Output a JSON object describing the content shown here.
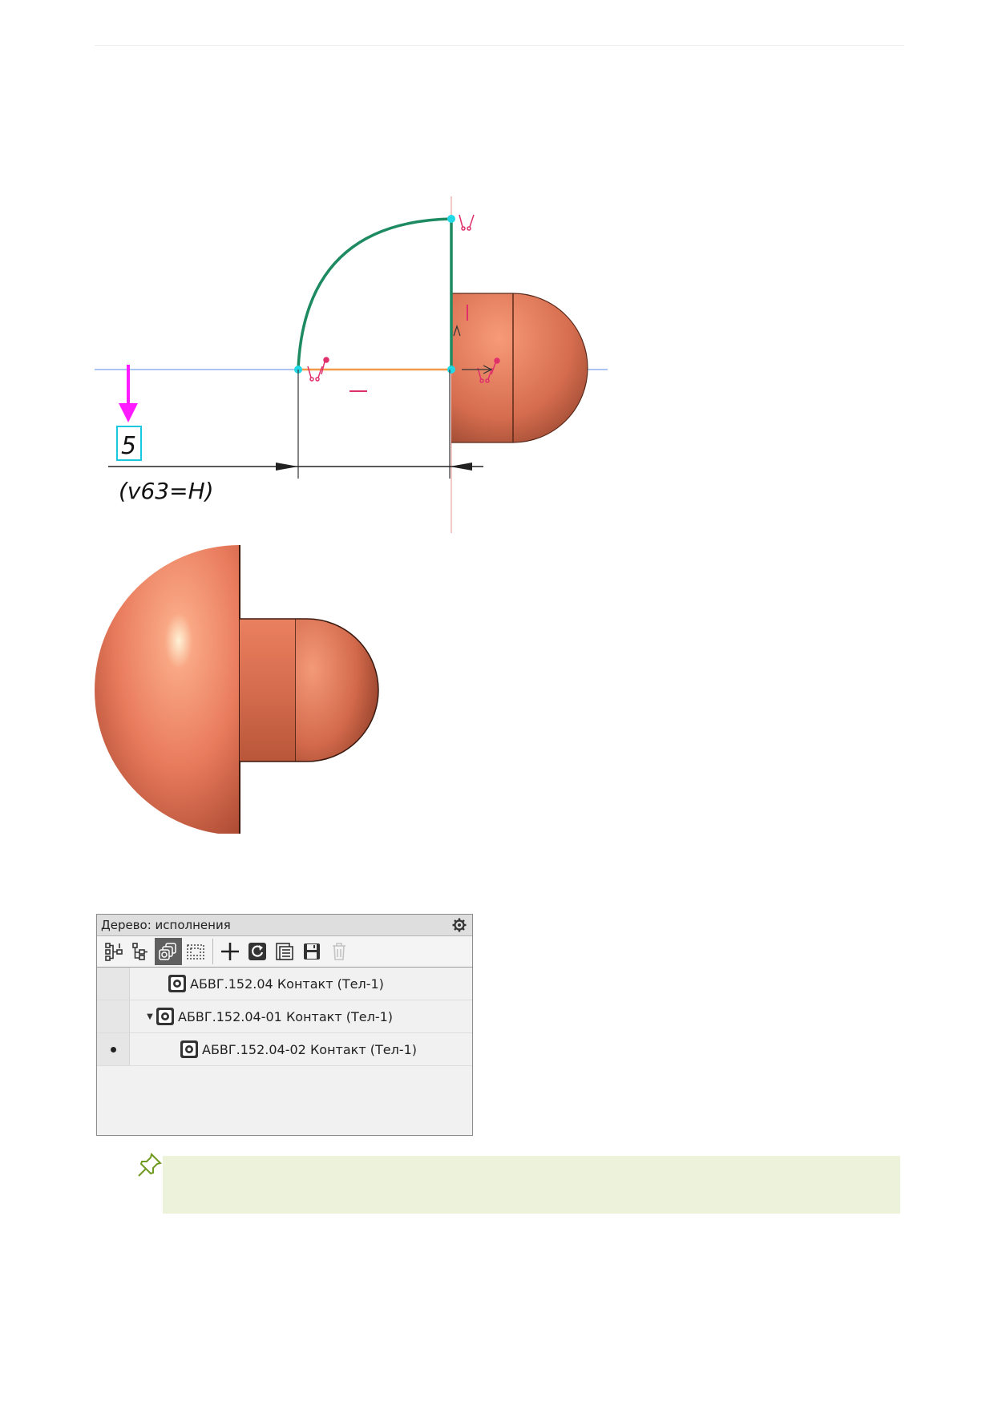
{
  "sketch": {
    "dimension_value": "5",
    "dimension_expression": "(v63=H)",
    "colors": {
      "axis_line": "#8fb0ec",
      "arc": "#1e8a62",
      "vertical_axis": "#f2b6b6",
      "segment": "#f29a4a",
      "point": "#21d9e6",
      "constraint": "#e0306a",
      "arrow": "#ff1aff",
      "dimension_box": "#19c8e0",
      "body": "#d56c4e"
    }
  },
  "part": {
    "body_color": "#e87a5c",
    "highlight_color": "#fff2d6"
  },
  "tree": {
    "title": "Дерево: исполнения",
    "gear_icon": "gear-icon",
    "toolbar": [
      {
        "name": "tree-structure-icon",
        "active": false
      },
      {
        "name": "tree-branch-icon",
        "active": false
      },
      {
        "name": "variants-icon",
        "active": true
      },
      {
        "name": "select-frame-icon",
        "active": false
      },
      {
        "name": "add-icon",
        "active": false
      },
      {
        "name": "refresh-icon",
        "active": false
      },
      {
        "name": "properties-icon",
        "active": false
      },
      {
        "name": "save-icon",
        "active": false
      },
      {
        "name": "delete-icon",
        "active": false
      }
    ],
    "rows": [
      {
        "label": "АБВГ.152.04 Контакт (Тел-1)",
        "level": 0,
        "expander": "",
        "current": false
      },
      {
        "label": "АБВГ.152.04-01 Контакт (Тел-1)",
        "level": 0,
        "expander": "▼",
        "current": false
      },
      {
        "label": "АБВГ.152.04-02 Контакт (Тел-1)",
        "level": 1,
        "expander": "",
        "current": true
      }
    ]
  },
  "note": {
    "icon": "pushpin-icon",
    "background": "#edf2da"
  }
}
